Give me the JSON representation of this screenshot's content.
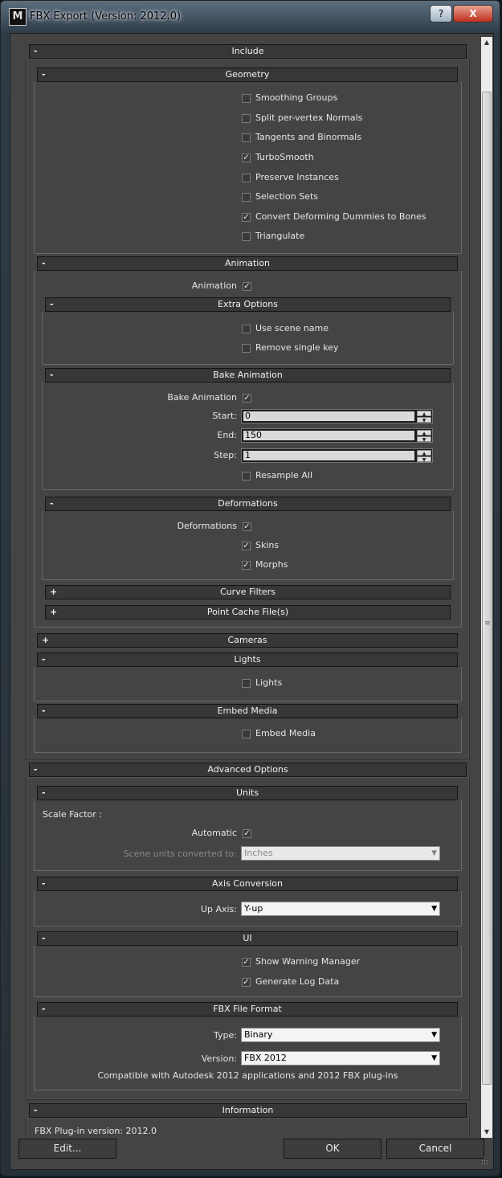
{
  "window": {
    "title": "FBX Export (Version: 2012.0)",
    "help_label": "?",
    "close_label": "X"
  },
  "include": {
    "title": "Include",
    "geometry": {
      "title": "Geometry",
      "options": [
        {
          "label": "Smoothing Groups",
          "checked": false
        },
        {
          "label": "Split per-vertex Normals",
          "checked": false
        },
        {
          "label": "Tangents and Binormals",
          "checked": false
        },
        {
          "label": "TurboSmooth",
          "checked": true
        },
        {
          "label": "Preserve Instances",
          "checked": false
        },
        {
          "label": "Selection Sets",
          "checked": false
        },
        {
          "label": "Convert Deforming Dummies to Bones",
          "checked": true
        },
        {
          "label": "Triangulate",
          "checked": false
        }
      ]
    },
    "animation": {
      "title": "Animation",
      "label": "Animation",
      "checked": true,
      "extra": {
        "title": "Extra Options",
        "options": [
          {
            "label": "Use scene name",
            "checked": false
          },
          {
            "label": "Remove single key",
            "checked": false
          }
        ]
      },
      "bake": {
        "title": "Bake Animation",
        "label": "Bake Animation",
        "checked": true,
        "start_label": "Start:",
        "start": "0",
        "end_label": "End:",
        "end": "150",
        "step_label": "Step:",
        "step": "1",
        "resample_label": "Resample All",
        "resample_checked": false
      },
      "deformations": {
        "title": "Deformations",
        "label": "Deformations",
        "checked": true,
        "skins_label": "Skins",
        "skins_checked": true,
        "morphs_label": "Morphs",
        "morphs_checked": true
      },
      "curve_filters": "Curve Filters",
      "point_cache": "Point Cache File(s)"
    },
    "cameras": "Cameras",
    "lights": {
      "title": "Lights",
      "label": "Lights",
      "checked": false
    },
    "embed": {
      "title": "Embed Media",
      "label": "Embed Media",
      "checked": false
    }
  },
  "advanced": {
    "title": "Advanced Options",
    "units": {
      "title": "Units",
      "scale_label": "Scale Factor :",
      "automatic_label": "Automatic",
      "automatic_checked": true,
      "converted_label": "Scene units converted to:",
      "converted_value": "Inches"
    },
    "axis": {
      "title": "Axis Conversion",
      "up_label": "Up Axis:",
      "up_value": "Y-up"
    },
    "ui": {
      "title": "UI",
      "options": [
        {
          "label": "Show Warning Manager",
          "checked": true
        },
        {
          "label": "Generate Log Data",
          "checked": true
        }
      ]
    },
    "format": {
      "title": "FBX File Format",
      "type_label": "Type:",
      "type_value": "Binary",
      "version_label": "Version:",
      "version_value": "FBX 2012",
      "compat_note": "Compatible with Autodesk 2012 applications and 2012 FBX plug-ins"
    }
  },
  "information": {
    "title": "Information",
    "plugin_version": "FBX Plug-in version: 2012.0"
  },
  "signs": {
    "collapse": "-",
    "expand": "+"
  },
  "check_glyph": "✓",
  "footer": {
    "edit_label": "Edit...",
    "ok_label": "OK",
    "cancel_label": "Cancel"
  }
}
